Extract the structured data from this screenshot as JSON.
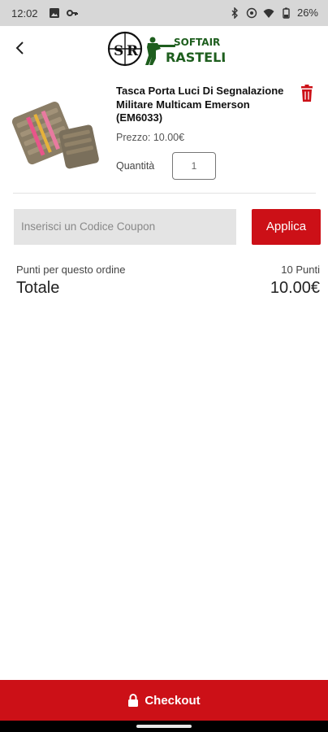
{
  "status_bar": {
    "time": "12:02",
    "battery": "26%",
    "icons": [
      "image-icon",
      "key-icon",
      "bluetooth-icon",
      "eye-icon",
      "wifi-icon",
      "battery-icon"
    ]
  },
  "header": {
    "back_icon": "chevron-left-icon",
    "logo": {
      "monogram_left": "S",
      "monogram_right": "R",
      "line1": "SOFTAIR",
      "line2": "RASTELLI"
    }
  },
  "cart_item": {
    "name": "Tasca Porta Luci Di Segnalazione Militare Multicam Emerson (EM6033)",
    "price": "Prezzo: 10.00€",
    "quantity_label": "Quantità",
    "quantity": "1",
    "delete_icon": "trash-icon"
  },
  "coupon": {
    "placeholder": "Inserisci un Codice Coupon",
    "apply_label": "Applica"
  },
  "summary": {
    "points_label": "Punti per questo ordine",
    "points_value": "10 Punti",
    "total_label": "Totale",
    "total_value": "10.00€"
  },
  "checkout": {
    "label": "Checkout",
    "icon": "lock-icon"
  },
  "colors": {
    "accent": "#cc1017",
    "logo_green": "#1e5e1e",
    "status_bar": "#d7d7d7"
  }
}
